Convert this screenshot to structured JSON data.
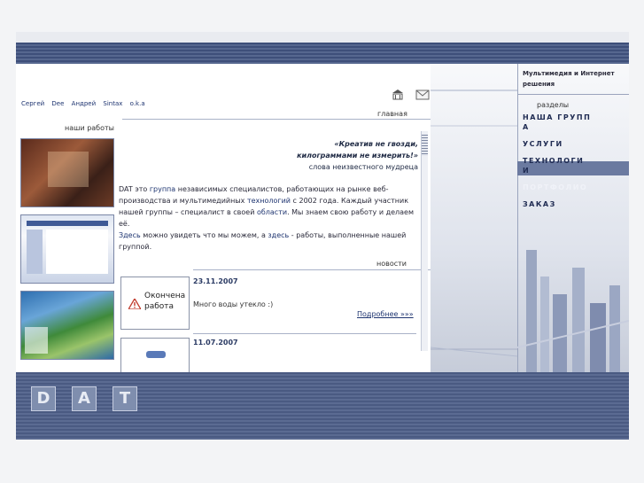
{
  "people": [
    "Сергей",
    "Dee",
    "Андрей",
    "Sintax",
    "o.k.a"
  ],
  "works_title": "наши работы",
  "nav": {
    "main": "главная"
  },
  "quote": {
    "line1": "«Креатив не гвозди,",
    "line2": "килограммами не измерить!»",
    "line3": "слова неизвестного мудреца"
  },
  "about": {
    "brand": "DAT",
    "p1": "это",
    "link_group": "группа",
    "p2": "независимых специалистов, работающих на рынке веб-производства и мультимедийных",
    "link_tech": "технологий",
    "p3": "с 2002 года. Каждый участник нашей группы – специалист в своей",
    "link_area": "области",
    "p4": ". Мы знаем свою работу и делаем её.",
    "link_here1": "Здесь",
    "p5": "можно увидеть что мы можем, а",
    "link_here2": "здесь",
    "p6": "- работы, выполненные нашей группой."
  },
  "news": {
    "title": "новости",
    "items": [
      {
        "date": "23.11.2007",
        "image_text": "Окончена работа",
        "text": "Много воды утекло :)",
        "more": "Подробнее »»»"
      },
      {
        "date": "11.07.2007"
      }
    ]
  },
  "right_panel": {
    "header": "Мультимедия и Интернет решения",
    "sections_label": "разделы",
    "menu": [
      "НАША ГРУПП А",
      "УСЛУГИ",
      "ТЕХНОЛОГИ И",
      "ПОРТФОЛИО",
      "ЗАКАЗ"
    ]
  },
  "logo_letters": [
    "D",
    "A",
    "T"
  ],
  "icons": [
    "home-icon",
    "mail-icon",
    "warning-icon"
  ],
  "colors": {
    "bar": "#4a5a82",
    "accent": "#1e3470"
  }
}
